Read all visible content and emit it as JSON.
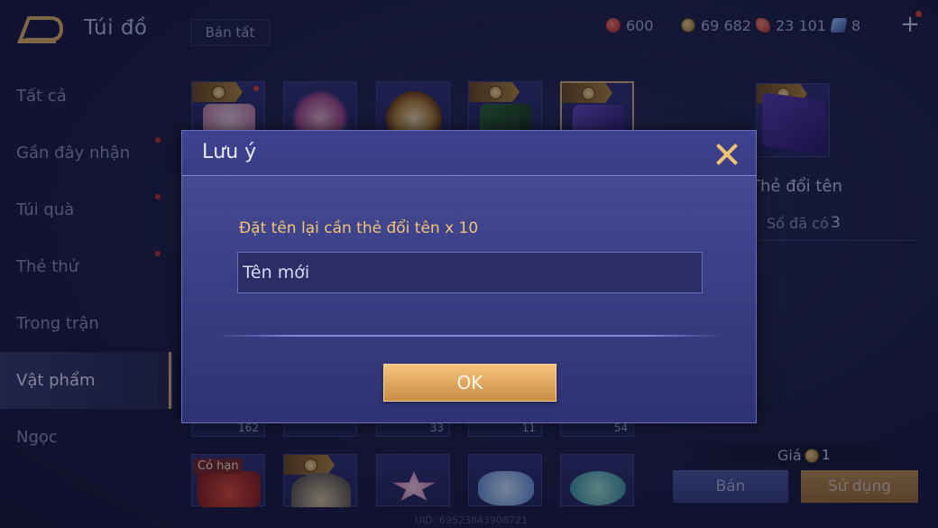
{
  "header": {
    "title": "Túi đồ",
    "sell_all_label": "Bán tất",
    "plus_label": "+"
  },
  "currencies": [
    {
      "icon": "red-gem-icon",
      "value": "600"
    },
    {
      "icon": "gold-coin-icon",
      "value": "69 682"
    },
    {
      "icon": "red-voucher-icon",
      "value": "23 101"
    },
    {
      "icon": "blue-card-icon",
      "value": "8"
    }
  ],
  "sidebar": {
    "items": [
      {
        "label": "Tất cả"
      },
      {
        "label": "Gần đây nhận"
      },
      {
        "label": "Túi quà"
      },
      {
        "label": "Thẻ thử"
      },
      {
        "label": "Trong trận"
      },
      {
        "label": "Vật phẩm"
      },
      {
        "label": "Ngọc"
      }
    ]
  },
  "grid": {
    "counts": [
      "162",
      "33",
      "11",
      "54"
    ],
    "tag": "Có hạn"
  },
  "detail": {
    "name": "Thẻ đổi tên",
    "owned_label": "Số đã có",
    "owned_value": "3",
    "price_label": "Giá",
    "price_value": "1",
    "sell_label": "Bán",
    "use_label": "Sử dụng"
  },
  "uid": "UID: 69523843908721",
  "modal": {
    "title": "Lưu ý",
    "message": "Đặt tên lại cần thẻ đổi tên x 10",
    "input_placeholder": "Tên mới",
    "input_value": "",
    "ok_label": "OK"
  },
  "colors": {
    "accent_gold": "#f0c36f",
    "message_gold": "#f1c476",
    "modal_bg": "#3c4087",
    "ok_button": "#dba15a"
  }
}
